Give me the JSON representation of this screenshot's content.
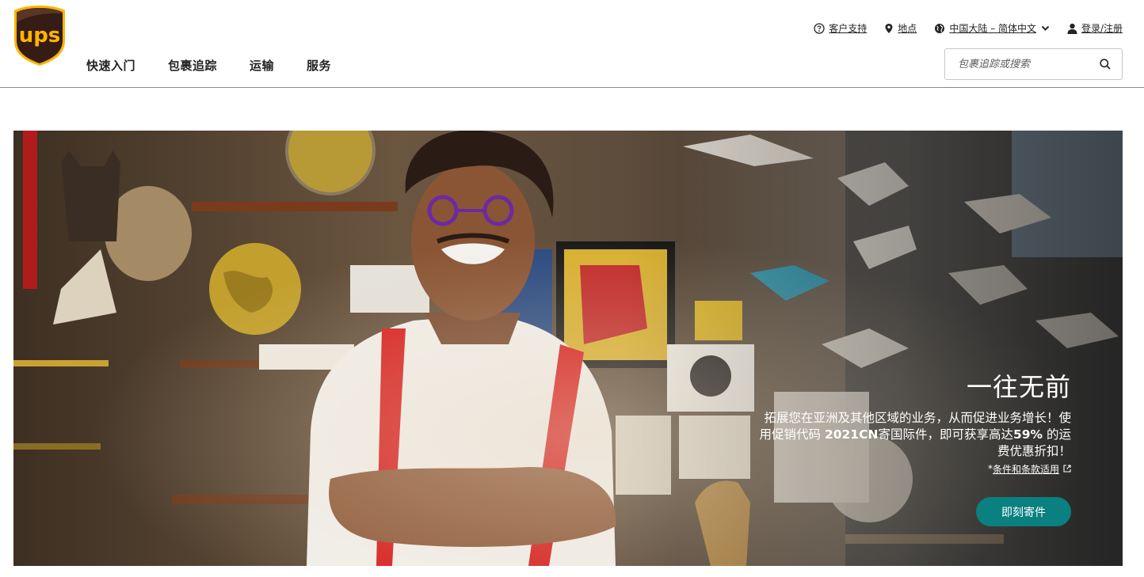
{
  "brand": {
    "logo_text": "ups",
    "colors": {
      "shield_dark": "#351c15",
      "shield_gold": "#ffb500",
      "accent_teal": "#0a8080"
    }
  },
  "main_nav": [
    {
      "label": "快速入门"
    },
    {
      "label": "包裹追踪"
    },
    {
      "label": "运输"
    },
    {
      "label": "服务"
    }
  ],
  "util_nav": {
    "support": {
      "label": "客户支持",
      "icon": "question-circle-icon"
    },
    "locations": {
      "label": "地点",
      "icon": "location-pin-icon"
    },
    "locale": {
      "label": "中国大陆 – 简体中文",
      "icon": "globe-icon"
    },
    "login": {
      "label": "登录/注册",
      "icon": "user-icon"
    }
  },
  "search": {
    "placeholder": "包裹追踪或搜索",
    "icon": "search-icon"
  },
  "hero": {
    "title": "一往无前",
    "desc_part1": "拓展您在亚洲及其他区域的业务，从而促进业务增长！使用促销代码 ",
    "promo_code": "2021CN",
    "desc_part2": "寄国际件，即可获享高达",
    "discount": "59%",
    "desc_part3": " 的运费优惠折扣！",
    "terms_prefix": "*",
    "terms_link": "条件和条款适用",
    "cta_label": "即刻寄件"
  }
}
